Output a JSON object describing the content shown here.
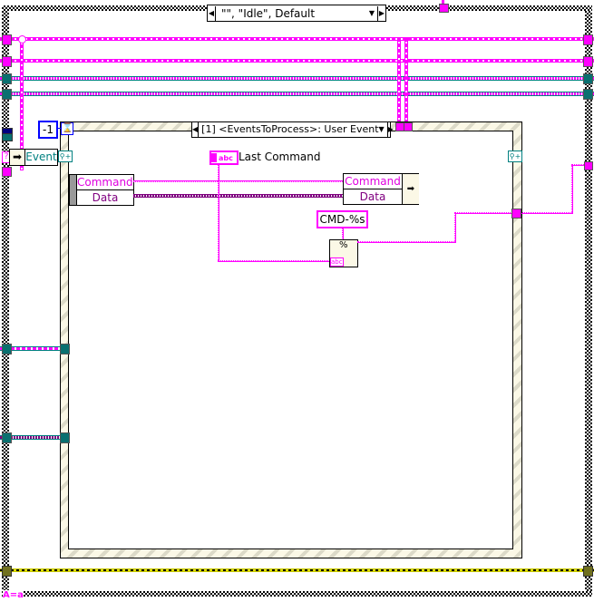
{
  "case_structure": {
    "selector_label": "\"\", \"Idle\", Default",
    "prev_icon": "triangle-left-icon",
    "next_icon": "triangle-right-icon",
    "dropdown_icon": "triangle-down-icon",
    "footer_glyph": "A=a"
  },
  "event_structure": {
    "selector_label": "[1] <EventsToProcess>: User Event",
    "timeout_constant": "-1",
    "timeout_icon": "hourglass-icon",
    "event_data_node_label": "Event",
    "event_data_fields": [
      "Command",
      "Data"
    ]
  },
  "nodes": {
    "local_variable_label": "Last Command",
    "local_variable_glyph": "abc",
    "bundle_by_name_fields": [
      "Command",
      "Data"
    ],
    "format_string_constant": "CMD-%s",
    "format_into_string_glyph": "%",
    "format_into_string_type": "abc"
  },
  "colors": {
    "string_wire": "#ff00ff",
    "cluster_wire": "#800080",
    "refnum_wire": "#008080",
    "error_wire": "#c8c800",
    "numeric_constant": "#0000ff"
  }
}
